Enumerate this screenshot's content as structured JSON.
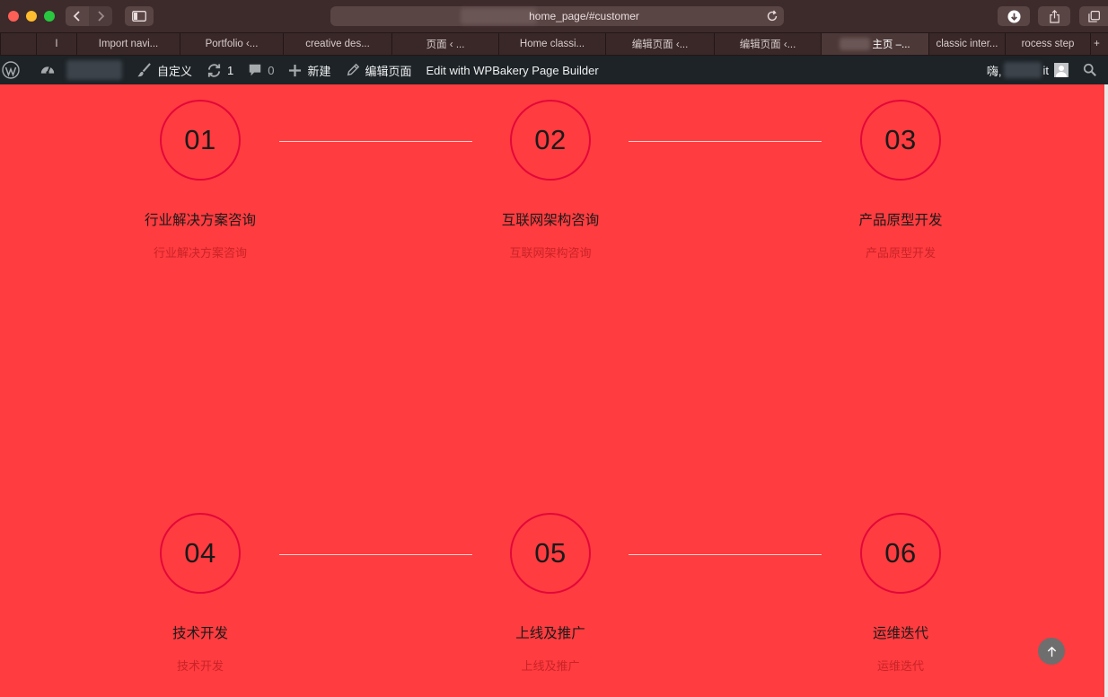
{
  "browser": {
    "url": "home_page/#customer",
    "tabs": [
      {
        "label": "I",
        "width": 45
      },
      {
        "label": "Import navi...",
        "width": 115
      },
      {
        "label": "Portfolio ‹...",
        "width": 115
      },
      {
        "label": "creative des...",
        "width": 121
      },
      {
        "label": "页面 ‹ ...",
        "width": 119
      },
      {
        "label": "Home classi...",
        "width": 119
      },
      {
        "label": "编辑页面 ‹...",
        "width": 121
      },
      {
        "label": "编辑页面 ‹...",
        "width": 119
      },
      {
        "label": "主页 –...",
        "width": 120
      },
      {
        "label": "classic inter...",
        "width": 85
      },
      {
        "label": "rocess step",
        "width": 95
      },
      {
        "label": "+",
        "width": 14
      }
    ]
  },
  "adminbar": {
    "customize": "自定义",
    "updates_count": "1",
    "comments_count": "0",
    "new": "新建",
    "edit_page": "编辑页面",
    "wpbakery": "Edit with WPBakery Page Builder",
    "greeting": "嗨,",
    "username_suffix": "it"
  },
  "steps": [
    {
      "num": "01",
      "title": "行业解决方案咨询",
      "subtitle": "行业解决方案咨询"
    },
    {
      "num": "02",
      "title": "互联网架构咨询",
      "subtitle": "互联网架构咨询"
    },
    {
      "num": "03",
      "title": "产品原型开发",
      "subtitle": "产品原型开发"
    },
    {
      "num": "04",
      "title": "技术开发",
      "subtitle": "技术开发"
    },
    {
      "num": "05",
      "title": "上线及推广",
      "subtitle": "上线及推广"
    },
    {
      "num": "06",
      "title": "运维迭代",
      "subtitle": "运维迭代"
    }
  ],
  "colors": {
    "page_bg": "#ff3c3f",
    "circle_border": "#e2083a",
    "adminbar_bg": "#1d2327"
  }
}
